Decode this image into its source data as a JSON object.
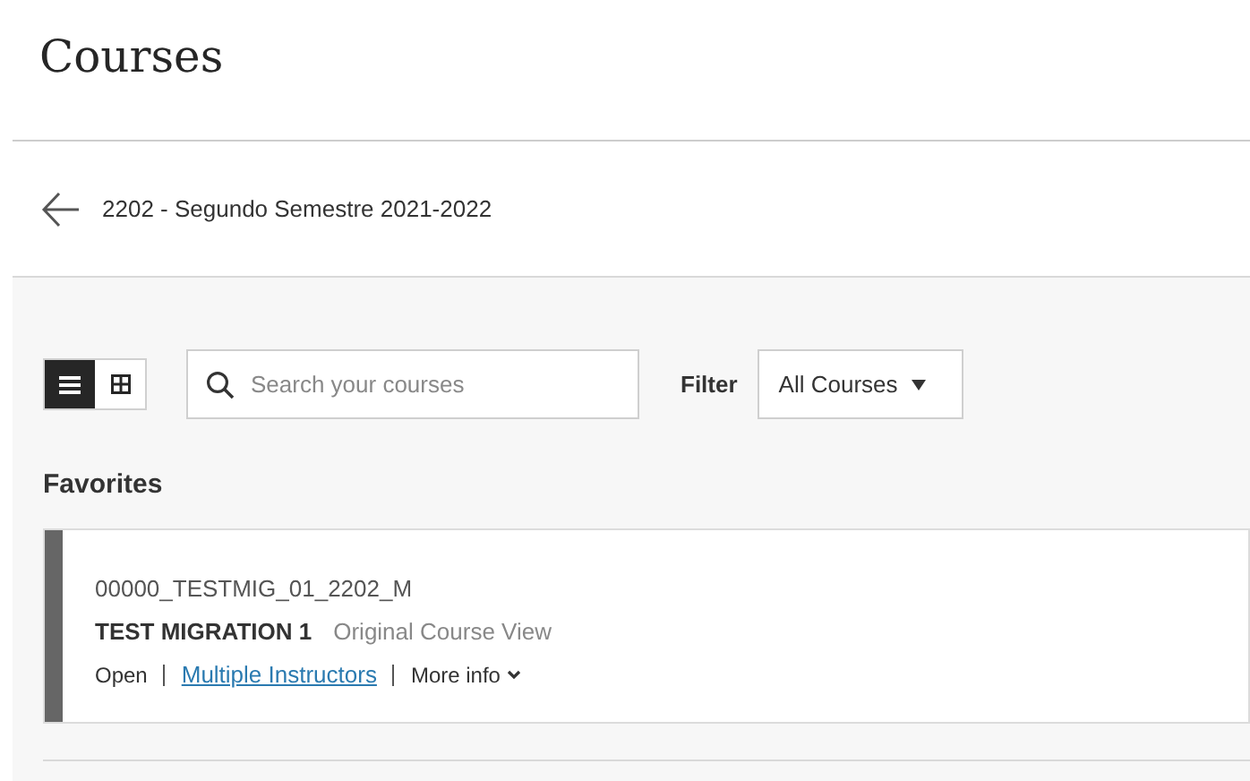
{
  "page_title": "Courses",
  "term": {
    "label": "2202 - Segundo Semestre 2021-2022"
  },
  "view_toggle": [
    {
      "kind": "list",
      "selected": true
    },
    {
      "kind": "grid",
      "selected": false
    }
  ],
  "search": {
    "placeholder": "Search your courses"
  },
  "filter": {
    "label": "Filter",
    "value": "All Courses"
  },
  "section_title": "Favorites",
  "courses": [
    {
      "id": "00000_TESTMIG_01_2202_M",
      "name": "TEST MIGRATION 1",
      "view": "Original Course View",
      "status": "Open",
      "instructors": "Multiple Instructors",
      "more": "More info"
    }
  ]
}
